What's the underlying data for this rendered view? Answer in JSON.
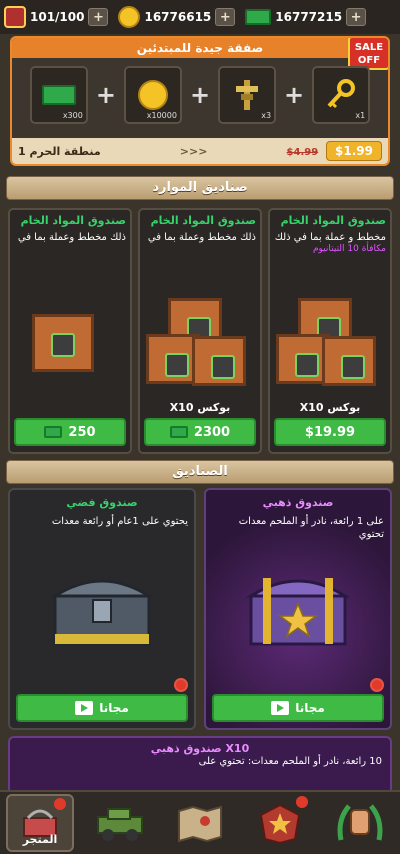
{
  "topbar": {
    "energy": "101/100",
    "coins": "16776615",
    "cash": "16777215"
  },
  "offer": {
    "title": "صفقة جيدة للمبتدئين",
    "sale_badge": "SALE\nOFF",
    "items": [
      {
        "qty": "x300",
        "icon": "cash-stack-icon"
      },
      {
        "qty": "x10000",
        "icon": "gold-coin-icon"
      },
      {
        "qty": "x3",
        "icon": "totem-icon"
      },
      {
        "qty": "x1",
        "icon": "key-icon"
      }
    ],
    "zone": "منطقة الحرم 1",
    "arrows": ">>>",
    "old_price": "$4.99",
    "price": "$1.99"
  },
  "resources_header": "صناديق الموارد",
  "resource_cards": [
    {
      "title": "صندوق المواد الخام",
      "desc": "ذلك مخطط وعملة بما في",
      "bonus": "",
      "x10": "",
      "price": "250",
      "icon": "cash-icon"
    },
    {
      "title": "صندوق المواد الخام",
      "desc": "ذلك مخطط وعملة بما في",
      "bonus": "",
      "x10": "X10 بوكس",
      "price": "2300",
      "icon": "cash-icon"
    },
    {
      "title": "صندوق المواد الخام",
      "desc": "مخطط و عملة بما في ذلك",
      "bonus": "مكافأة 10 التيتانيوم",
      "x10": "X10 بوكس",
      "price": "$19.99",
      "icon": ""
    }
  ],
  "boxes_header": "الصناديق",
  "chests": [
    {
      "title": "صندوق فضي",
      "desc": "يحتوي على 1عام أو رائعة معدات",
      "button": "مجانا"
    },
    {
      "title": "صندوق ذهبي",
      "desc": "على 1 رائعة، نادر أو الملحم معدات تحتوي",
      "button": "مجانا"
    }
  ],
  "promo": {
    "title": "صندوق ذهبي X10",
    "desc": "10 رائعة، نادر أو الملحم معدات: تحتوي على"
  },
  "nav": {
    "shop_label": "المتجر"
  }
}
